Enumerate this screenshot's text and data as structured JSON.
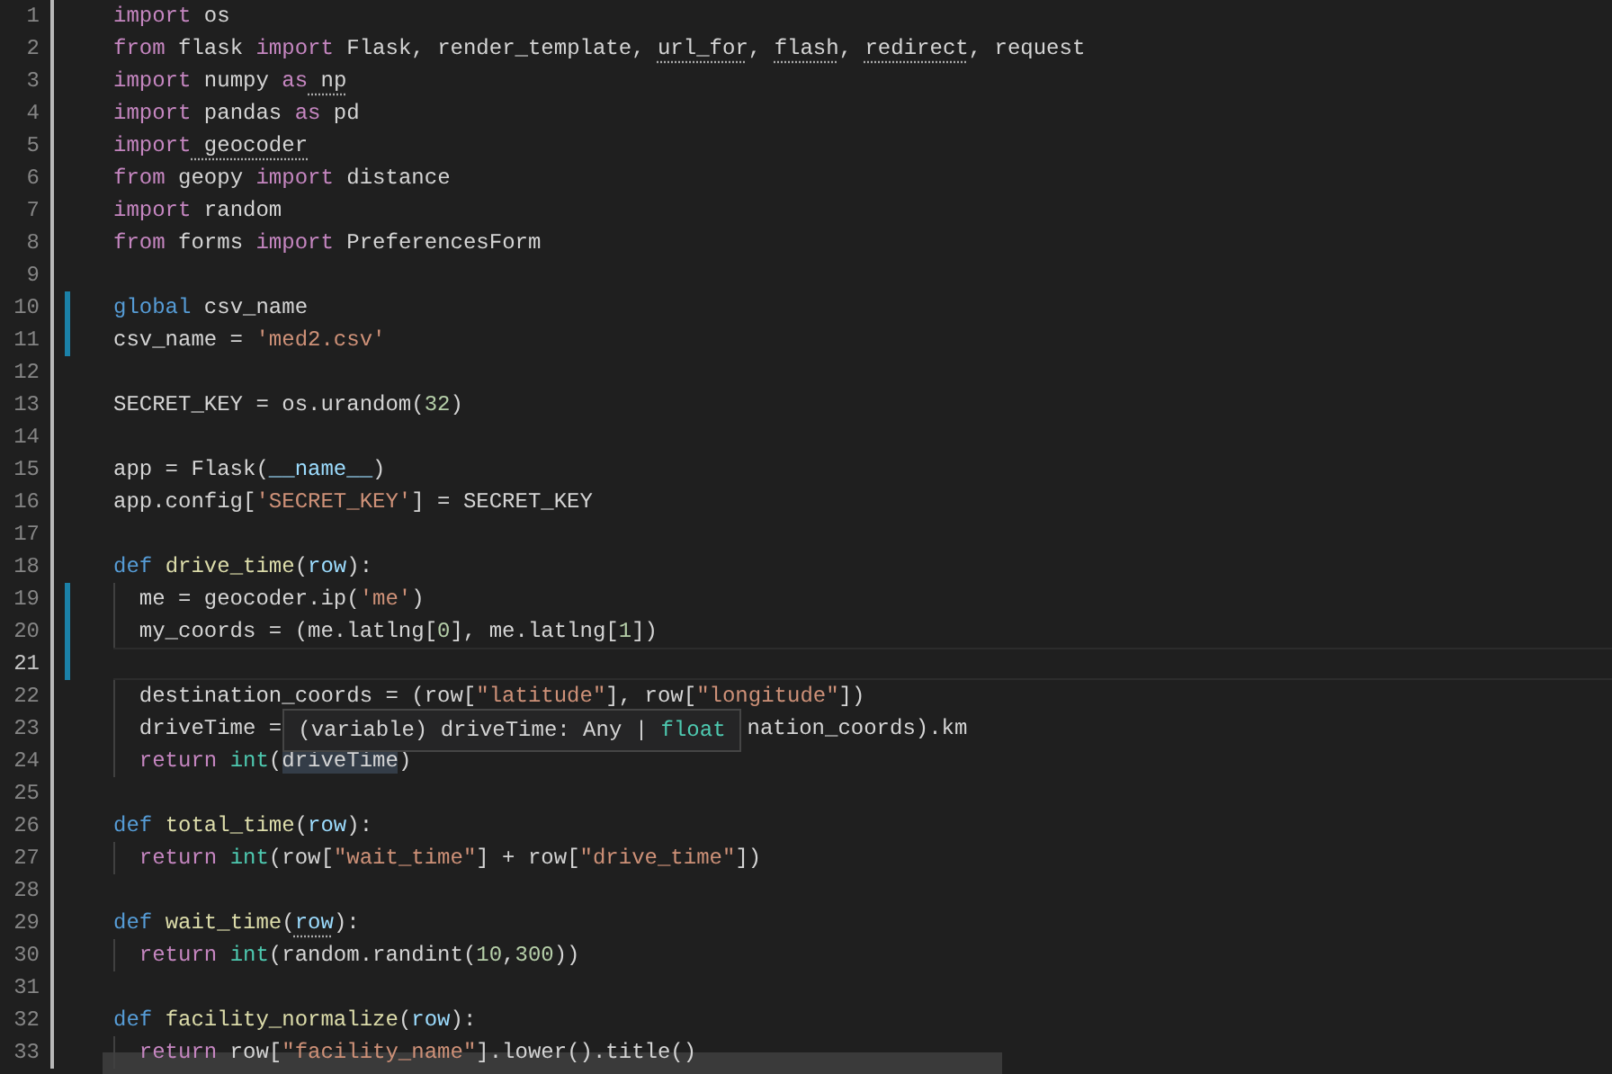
{
  "lines": [
    {
      "number": "1",
      "tokens": [
        {
          "text": "import",
          "kind": "kw"
        },
        {
          "text": " os",
          "kind": "plain"
        }
      ]
    },
    {
      "number": "2",
      "tokens": [
        {
          "text": "from",
          "kind": "kw"
        },
        {
          "text": " flask ",
          "kind": "plain"
        },
        {
          "text": "import",
          "kind": "kw"
        },
        {
          "text": " Flask, render_template, ",
          "kind": "plain"
        },
        {
          "text": "url_for",
          "kind": "plain",
          "warning": true
        },
        {
          "text": ", ",
          "kind": "plain"
        },
        {
          "text": "flash",
          "kind": "plain",
          "warning": true
        },
        {
          "text": ", ",
          "kind": "plain"
        },
        {
          "text": "redirect",
          "kind": "plain",
          "warning": true
        },
        {
          "text": ", request",
          "kind": "plain"
        }
      ]
    },
    {
      "number": "3",
      "tokens": [
        {
          "text": "import",
          "kind": "kw"
        },
        {
          "text": " numpy ",
          "kind": "plain"
        },
        {
          "text": "as",
          "kind": "kw"
        },
        {
          "text": " np",
          "kind": "plain",
          "warning": true
        }
      ]
    },
    {
      "number": "4",
      "tokens": [
        {
          "text": "import",
          "kind": "kw"
        },
        {
          "text": " pandas ",
          "kind": "plain"
        },
        {
          "text": "as",
          "kind": "kw"
        },
        {
          "text": " pd",
          "kind": "plain"
        }
      ]
    },
    {
      "number": "5",
      "tokens": [
        {
          "text": "import",
          "kind": "kw"
        },
        {
          "text": " geocoder",
          "kind": "plain",
          "warning": true
        }
      ]
    },
    {
      "number": "6",
      "tokens": [
        {
          "text": "from",
          "kind": "kw"
        },
        {
          "text": " geopy ",
          "kind": "plain"
        },
        {
          "text": "import",
          "kind": "kw"
        },
        {
          "text": " distance",
          "kind": "plain"
        }
      ]
    },
    {
      "number": "7",
      "tokens": [
        {
          "text": "import",
          "kind": "kw"
        },
        {
          "text": " random",
          "kind": "plain"
        }
      ]
    },
    {
      "number": "8",
      "tokens": [
        {
          "text": "from",
          "kind": "kw"
        },
        {
          "text": " forms ",
          "kind": "plain"
        },
        {
          "text": "import",
          "kind": "kw"
        },
        {
          "text": " PreferencesForm",
          "kind": "plain"
        }
      ]
    },
    {
      "number": "9"
    },
    {
      "number": "10",
      "modified": true,
      "tokens": [
        {
          "text": "global",
          "kind": "storage"
        },
        {
          "text": " csv_name",
          "kind": "plain"
        }
      ]
    },
    {
      "number": "11",
      "modified": true,
      "tokens": [
        {
          "text": "csv_name = ",
          "kind": "plain"
        },
        {
          "text": "'med2.csv'",
          "kind": "str"
        }
      ]
    },
    {
      "number": "12"
    },
    {
      "number": "13",
      "tokens": [
        {
          "text": "SECRET_KEY = os.urandom(",
          "kind": "plain"
        },
        {
          "text": "32",
          "kind": "num"
        },
        {
          "text": ")",
          "kind": "plain"
        }
      ]
    },
    {
      "number": "14"
    },
    {
      "number": "15",
      "tokens": [
        {
          "text": "app = Flask(",
          "kind": "plain"
        },
        {
          "text": "__name__",
          "kind": "param"
        },
        {
          "text": ")",
          "kind": "plain"
        }
      ]
    },
    {
      "number": "16",
      "tokens": [
        {
          "text": "app.config[",
          "kind": "plain"
        },
        {
          "text": "'SECRET_KEY'",
          "kind": "str"
        },
        {
          "text": "] = SECRET_KEY",
          "kind": "plain"
        }
      ]
    },
    {
      "number": "17"
    },
    {
      "number": "18",
      "tokens": [
        {
          "text": "def ",
          "kind": "storage"
        },
        {
          "text": "drive_time",
          "kind": "fn"
        },
        {
          "text": "(",
          "kind": "plain"
        },
        {
          "text": "row",
          "kind": "param"
        },
        {
          "text": "):",
          "kind": "plain"
        }
      ]
    },
    {
      "number": "19",
      "modified": true,
      "tokens": [
        {
          "text": "  me = geocoder.ip(",
          "kind": "plain"
        },
        {
          "text": "'me'",
          "kind": "str"
        },
        {
          "text": ")",
          "kind": "plain"
        }
      ]
    },
    {
      "number": "20",
      "modified": true,
      "tokens": [
        {
          "text": "  my_coords = (me.latlng[",
          "kind": "plain"
        },
        {
          "text": "0",
          "kind": "num"
        },
        {
          "text": "], me.latlng[",
          "kind": "plain"
        },
        {
          "text": "1",
          "kind": "num"
        },
        {
          "text": "])",
          "kind": "plain"
        }
      ]
    },
    {
      "number": "21",
      "modified": true,
      "current": true
    },
    {
      "number": "22",
      "tokens": [
        {
          "text": "  destination_coords = (row[",
          "kind": "plain"
        },
        {
          "text": "\"latitude\"",
          "kind": "str"
        },
        {
          "text": "], row[",
          "kind": "plain"
        },
        {
          "text": "\"longitude\"",
          "kind": "str"
        },
        {
          "text": "])",
          "kind": "plain"
        }
      ]
    },
    {
      "number": "23",
      "tokens": [
        {
          "text": "  driveTime =",
          "kind": "plain"
        }
      ],
      "tooltip": [
        {
          "text": "(variable) driveTime: Any | ",
          "kind": "plain"
        },
        {
          "text": "float",
          "kind": "builtin"
        }
      ],
      "tokens_after_tooltip": [
        {
          "text": "nation_coords).km",
          "kind": "plain"
        }
      ]
    },
    {
      "number": "24",
      "tokens": [
        {
          "text": "  return ",
          "kind": "kw"
        },
        {
          "text": "int",
          "kind": "builtin"
        },
        {
          "text": "(",
          "kind": "plain"
        },
        {
          "text": "driveTime",
          "kind": "plain",
          "highlighted": true
        },
        {
          "text": ")",
          "kind": "plain"
        }
      ]
    },
    {
      "number": "25"
    },
    {
      "number": "26",
      "tokens": [
        {
          "text": "def ",
          "kind": "storage"
        },
        {
          "text": "total_time",
          "kind": "fn"
        },
        {
          "text": "(",
          "kind": "plain"
        },
        {
          "text": "row",
          "kind": "param"
        },
        {
          "text": "):",
          "kind": "plain"
        }
      ]
    },
    {
      "number": "27",
      "tokens": [
        {
          "text": "  return ",
          "kind": "kw"
        },
        {
          "text": "int",
          "kind": "builtin"
        },
        {
          "text": "(row[",
          "kind": "plain"
        },
        {
          "text": "\"wait_time\"",
          "kind": "str"
        },
        {
          "text": "] + row[",
          "kind": "plain"
        },
        {
          "text": "\"drive_time\"",
          "kind": "str"
        },
        {
          "text": "])",
          "kind": "plain"
        }
      ]
    },
    {
      "number": "28"
    },
    {
      "number": "29",
      "tokens": [
        {
          "text": "def ",
          "kind": "storage"
        },
        {
          "text": "wait_time",
          "kind": "fn"
        },
        {
          "text": "(",
          "kind": "plain"
        },
        {
          "text": "row",
          "kind": "param",
          "warning": true
        },
        {
          "text": "):",
          "kind": "plain"
        }
      ]
    },
    {
      "number": "30",
      "tokens": [
        {
          "text": "  return ",
          "kind": "kw"
        },
        {
          "text": "int",
          "kind": "builtin"
        },
        {
          "text": "(random.randint(",
          "kind": "plain"
        },
        {
          "text": "10",
          "kind": "num"
        },
        {
          "text": ",",
          "kind": "plain"
        },
        {
          "text": "300",
          "kind": "num"
        },
        {
          "text": "))",
          "kind": "plain"
        }
      ]
    },
    {
      "number": "31"
    },
    {
      "number": "32",
      "tokens": [
        {
          "text": "def ",
          "kind": "storage"
        },
        {
          "text": "facility_normalize",
          "kind": "fn"
        },
        {
          "text": "(",
          "kind": "plain"
        },
        {
          "text": "row",
          "kind": "param"
        },
        {
          "text": "):",
          "kind": "plain"
        }
      ]
    },
    {
      "number": "33",
      "tokens": [
        {
          "text": "  return",
          "kind": "kw"
        },
        {
          "text": " row[",
          "kind": "plain"
        },
        {
          "text": "\"facility_name\"",
          "kind": "str"
        },
        {
          "text": "].lower().title()",
          "kind": "plain"
        }
      ]
    }
  ]
}
